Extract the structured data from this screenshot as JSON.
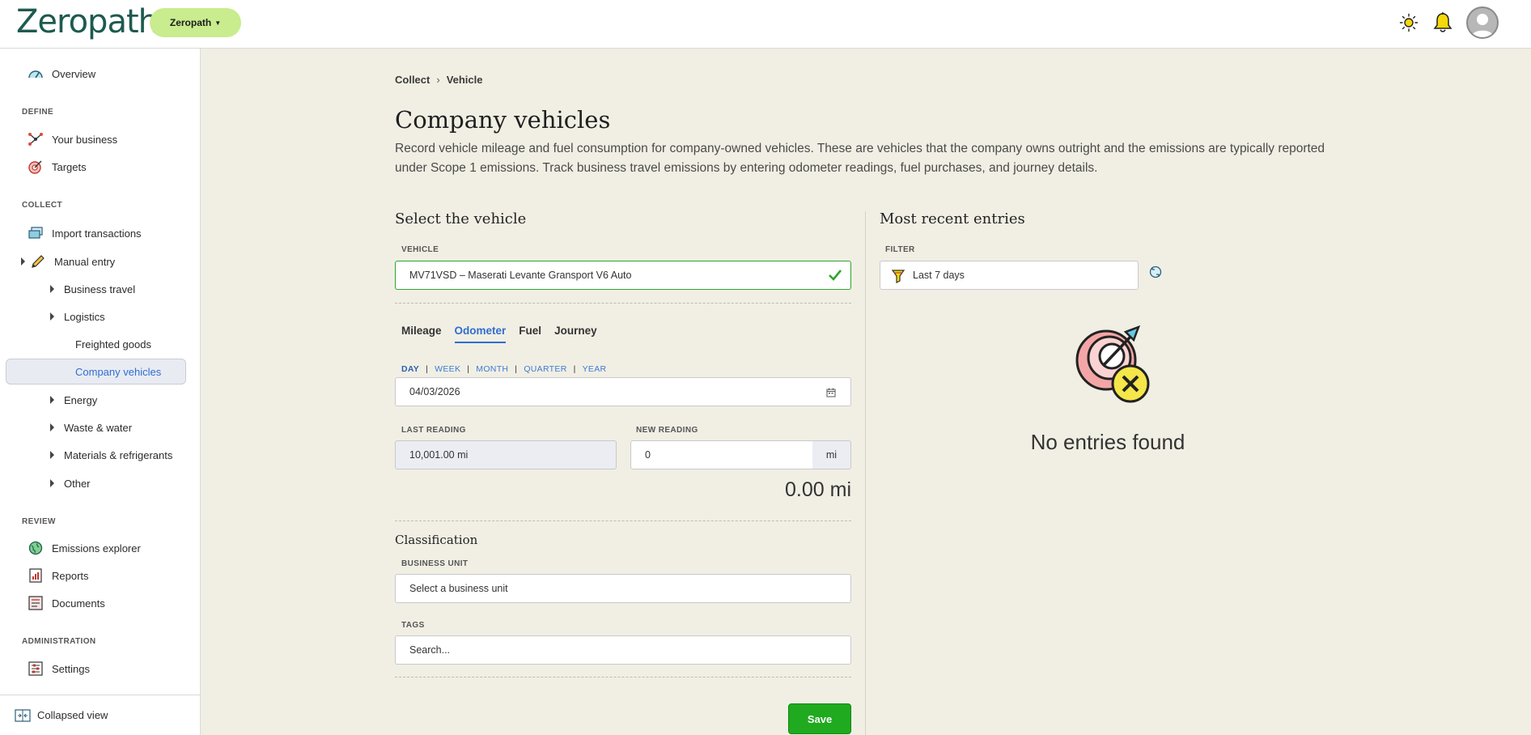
{
  "header": {
    "logo_text": "Zeropath",
    "org_switcher_label": "Zeropath",
    "colors": {
      "accent_green": "#c9ec8e",
      "brand_teal": "#1e5a4f",
      "link_blue": "#2f6ed0",
      "save_green": "#1faa1f"
    }
  },
  "sidebar": {
    "overview": "Overview",
    "sections": {
      "define": "DEFINE",
      "collect": "COLLECT",
      "review": "REVIEW",
      "administration": "ADMINISTRATION"
    },
    "items": {
      "your_business": "Your business",
      "targets": "Targets",
      "import_transactions": "Import transactions",
      "manual_entry": "Manual entry",
      "business_travel": "Business travel",
      "logistics": "Logistics",
      "freighted_goods": "Freighted goods",
      "company_vehicles": "Company vehicles",
      "energy": "Energy",
      "waste_water": "Waste & water",
      "materials_refrigerants": "Materials & refrigerants",
      "other": "Other",
      "emissions_explorer": "Emissions explorer",
      "reports": "Reports",
      "documents": "Documents",
      "settings": "Settings"
    },
    "collapsed_view": "Collapsed view"
  },
  "main": {
    "breadcrumb": {
      "parent": "Collect",
      "separator": "›",
      "current": "Vehicle"
    },
    "title": "Company vehicles",
    "description": "Record vehicle mileage and fuel consumption for company-owned vehicles. These are vehicles that the company owns outright and the emissions are typically reported under Scope 1 emissions. Track business travel emissions by entering odometer readings, fuel purchases, and journey details.",
    "form": {
      "section_title": "Select the vehicle",
      "vehicle_label": "VEHICLE",
      "vehicle_value": "MV71VSD – Maserati Levante Gransport V6 Auto",
      "tabs": [
        "Mileage",
        "Odometer",
        "Fuel",
        "Journey"
      ],
      "active_tab": "Odometer",
      "periods": [
        "DAY",
        "WEEK",
        "MONTH",
        "QUARTER",
        "YEAR"
      ],
      "active_period": "DAY",
      "date_value": "04/03/2026",
      "last_reading_label": "LAST READING",
      "last_reading_value": "10,001.00 mi",
      "new_reading_label": "NEW READING",
      "new_reading_value": "0",
      "unit": "mi",
      "total": "0.00 mi",
      "classification_title": "Classification",
      "business_unit_label": "BUSINESS UNIT",
      "business_unit_placeholder": "Select a business unit",
      "tags_label": "TAGS",
      "tags_placeholder": "Search...",
      "save_label": "Save"
    },
    "recent": {
      "title": "Most recent entries",
      "filter_label": "FILTER",
      "filter_value": "Last 7 days",
      "empty_message": "No entries found"
    }
  }
}
